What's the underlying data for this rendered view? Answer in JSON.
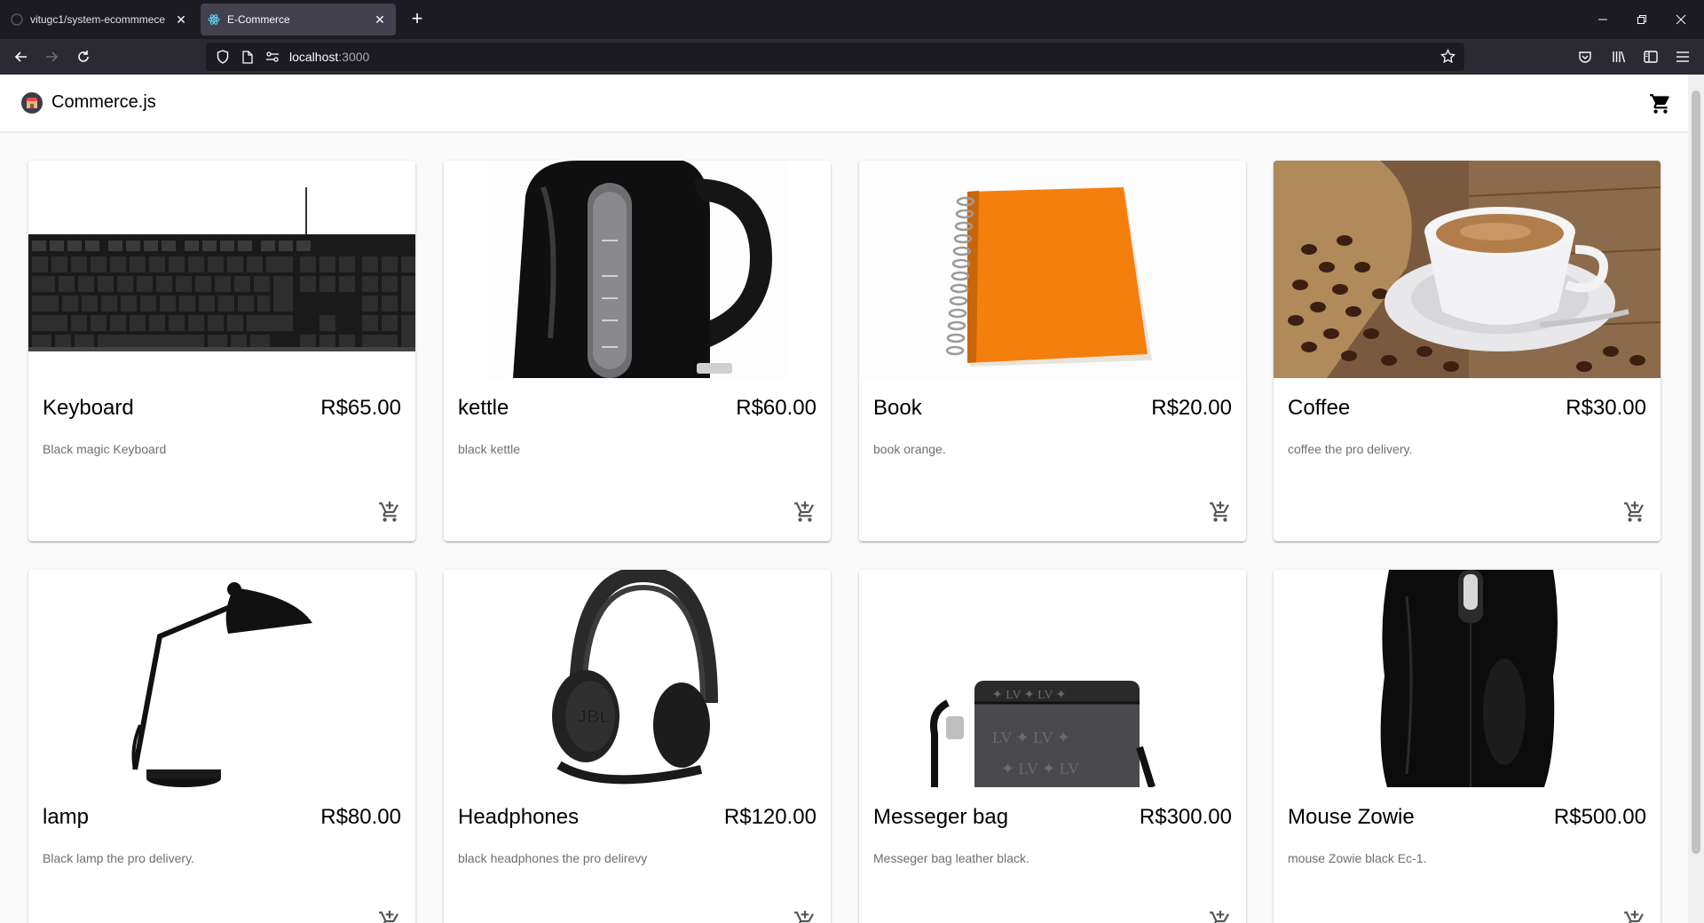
{
  "browser": {
    "tabs": [
      {
        "label": "vitugc1/system-ecommmece",
        "active": false
      },
      {
        "label": "E-Commerce",
        "active": true
      }
    ],
    "url_host": "localhost",
    "url_port": ":3000"
  },
  "app": {
    "brand": "Commerce.js"
  },
  "products": [
    {
      "name": "Keyboard",
      "price": "R$65.00",
      "description": "Black magic Keyboard",
      "image": "keyboard"
    },
    {
      "name": "kettle",
      "price": "R$60.00",
      "description": "black kettle",
      "image": "kettle"
    },
    {
      "name": "Book",
      "price": "R$20.00",
      "description": "book orange.",
      "image": "book"
    },
    {
      "name": "Coffee",
      "price": "R$30.00",
      "description": "coffee the pro delivery.",
      "image": "coffee"
    },
    {
      "name": "lamp",
      "price": "R$80.00",
      "description": "Black lamp the pro delivery.",
      "image": "lamp"
    },
    {
      "name": "Headphones",
      "price": "R$120.00",
      "description": "black headphones the pro delirevy",
      "image": "headphones"
    },
    {
      "name": "Messeger bag",
      "price": "R$300.00",
      "description": "Messeger bag leather black.",
      "image": "bag"
    },
    {
      "name": "Mouse Zowie",
      "price": "R$500.00",
      "description": "mouse Zowie black Ec-1.",
      "image": "mouse"
    }
  ],
  "icons": {
    "cart": "cart-icon",
    "add_to_cart": "add-shopping-cart-icon"
  }
}
